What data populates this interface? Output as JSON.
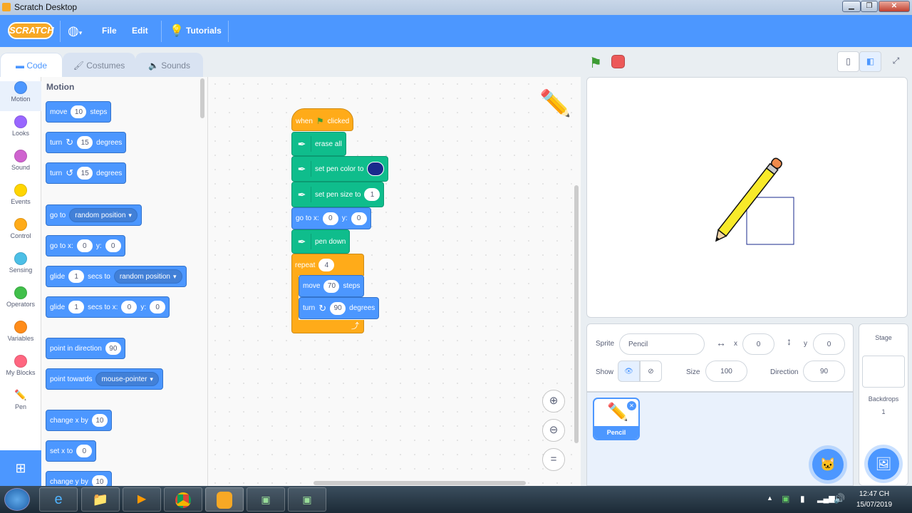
{
  "window": {
    "title": "Scratch Desktop",
    "controls": [
      "minimize-icon",
      "maximize-icon",
      "close-icon"
    ]
  },
  "menu": {
    "logo": "SCRATCH",
    "language_icon": "globe-icon",
    "file": "File",
    "edit": "Edit",
    "tutorials": "Tutorials"
  },
  "tabs": [
    {
      "label": "Code"
    },
    {
      "label": "Costumes"
    },
    {
      "label": "Sounds"
    }
  ],
  "categories": [
    {
      "label": "Motion",
      "color": "#4c97ff"
    },
    {
      "label": "Looks",
      "color": "#9966ff"
    },
    {
      "label": "Sound",
      "color": "#cf63cf"
    },
    {
      "label": "Events",
      "color": "#ffd500"
    },
    {
      "label": "Control",
      "color": "#ffab19"
    },
    {
      "label": "Sensing",
      "color": "#4cbfe6"
    },
    {
      "label": "Operators",
      "color": "#40bf4a"
    },
    {
      "label": "Variables",
      "color": "#ff8c1a"
    },
    {
      "label": "My Blocks",
      "color": "#ff6680"
    },
    {
      "label": "Pen",
      "color": "#0fbd8c"
    }
  ],
  "palette": {
    "section_title": "Motion",
    "move": {
      "a": "move",
      "n": "10",
      "b": "steps"
    },
    "turn_right": {
      "a": "turn",
      "n": "15",
      "b": "degrees"
    },
    "turn_left": {
      "a": "turn",
      "n": "15",
      "b": "degrees"
    },
    "goto": {
      "a": "go to",
      "opt": "random position"
    },
    "gotoxy": {
      "a": "go to x:",
      "x": "0",
      "b": "y:",
      "y": "0"
    },
    "glide": {
      "a": "glide",
      "n": "1",
      "b": "secs to",
      "opt": "random position"
    },
    "glidexy": {
      "a": "glide",
      "n": "1",
      "b": "secs to x:",
      "x": "0",
      "c": "y:",
      "y": "0"
    },
    "point_dir": {
      "a": "point in direction",
      "n": "90"
    },
    "point_towards": {
      "a": "point towards",
      "opt": "mouse-pointer"
    },
    "change_x": {
      "a": "change x by",
      "n": "10"
    },
    "set_x": {
      "a": "set x to",
      "n": "0"
    },
    "change_y": {
      "a": "change y by",
      "n": "10"
    }
  },
  "script": {
    "hat": {
      "a": "when",
      "b": "clicked"
    },
    "erase": "erase all",
    "pen_color": "set pen color to",
    "pen_color_value": "#1a2a8c",
    "pen_size": {
      "a": "set pen size to",
      "n": "1"
    },
    "gotoxy": {
      "a": "go to x:",
      "x": "0",
      "b": "y:",
      "y": "0"
    },
    "pen_down": "pen down",
    "repeat": {
      "a": "repeat",
      "n": "4"
    },
    "move": {
      "a": "move",
      "n": "70",
      "b": "steps"
    },
    "turn": {
      "a": "turn",
      "n": "90",
      "b": "degrees"
    }
  },
  "sprite": {
    "sprite_label": "Sprite",
    "name": "Pencil",
    "x_label": "x",
    "x": "0",
    "y_label": "y",
    "y": "0",
    "show_label": "Show",
    "size_label": "Size",
    "size": "100",
    "direction_label": "Direction",
    "direction": "90",
    "thumbnail_label": "Pencil"
  },
  "stage_panel": {
    "title": "Stage",
    "backdrops_label": "Backdrops",
    "backdrops_count": "1"
  },
  "taskbar": {
    "time": "12:47 CH",
    "date": "15/07/2019"
  }
}
